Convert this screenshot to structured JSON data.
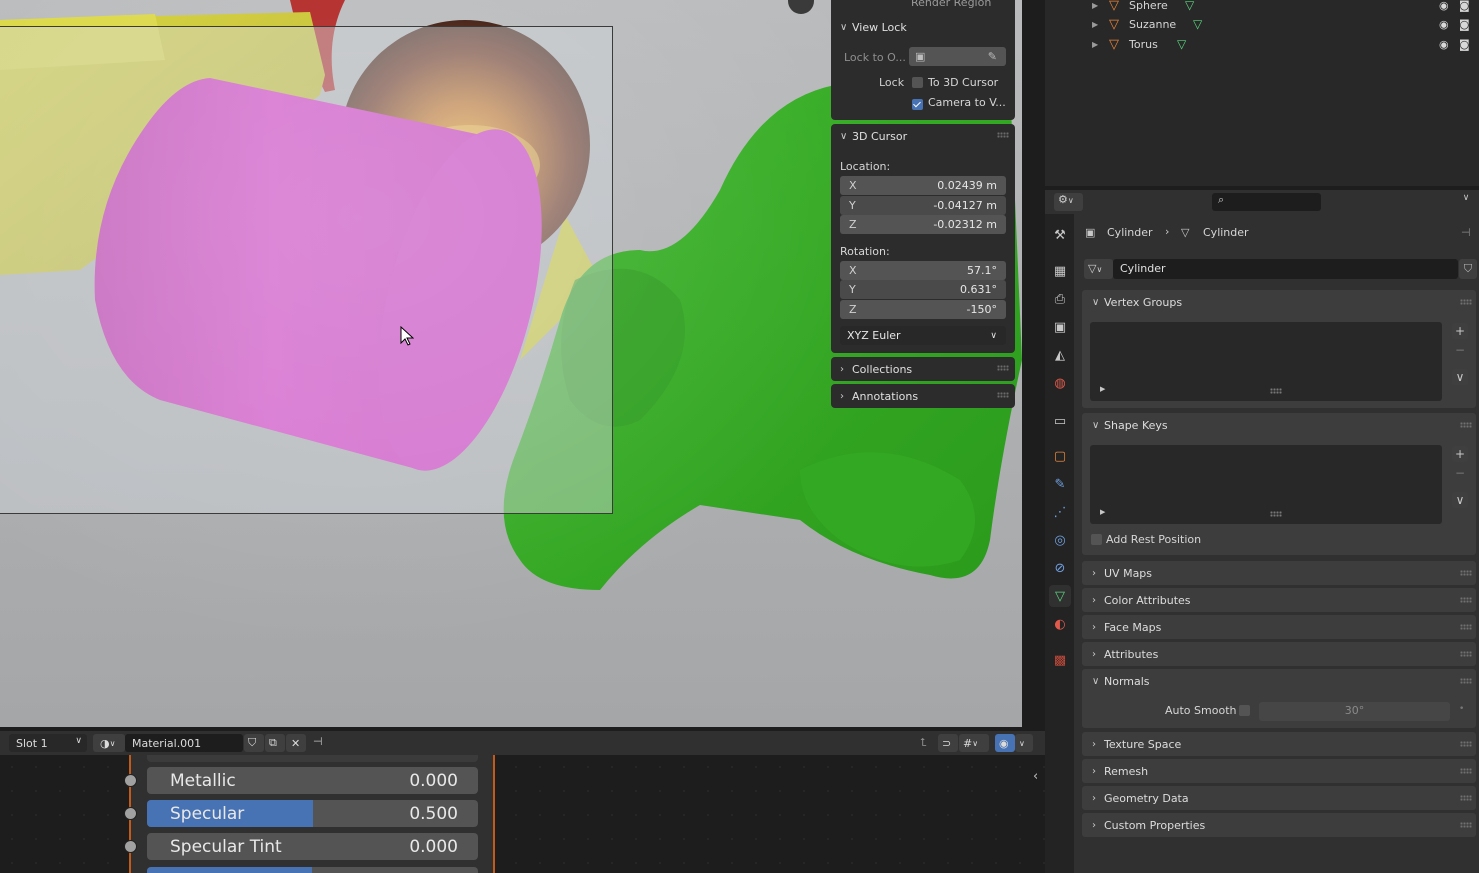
{
  "viewport": {
    "render_region_label": "Render Region",
    "view_lock": {
      "header": "View Lock",
      "lock_to_object_label": "Lock to O...",
      "lock_label": "Lock",
      "to_3d_cursor_label": "To 3D Cursor",
      "to_3d_cursor_checked": false,
      "camera_to_view_label": "Camera to V...",
      "camera_to_view_checked": true
    },
    "cursor": {
      "header": "3D Cursor",
      "location_label": "Location:",
      "location": [
        {
          "axis": "X",
          "value": "0.02439 m"
        },
        {
          "axis": "Y",
          "value": "-0.04127 m"
        },
        {
          "axis": "Z",
          "value": "-0.02312 m"
        }
      ],
      "rotation_label": "Rotation:",
      "rotation": [
        {
          "axis": "X",
          "value": "57.1°"
        },
        {
          "axis": "Y",
          "value": "0.631°"
        },
        {
          "axis": "Z",
          "value": "-150°"
        }
      ],
      "rotation_mode": "XYZ Euler"
    },
    "collections_header": "Collections",
    "annotations_header": "Annotations"
  },
  "outliner": {
    "items": [
      {
        "name": "Sphere"
      },
      {
        "name": "Suzanne"
      },
      {
        "name": "Torus"
      }
    ]
  },
  "properties": {
    "breadcrumb_object": "Cylinder",
    "breadcrumb_data": "Cylinder",
    "mesh_name": "Cylinder",
    "panels": {
      "vertex_groups": "Vertex Groups",
      "shape_keys": "Shape Keys",
      "add_rest_position": "Add Rest Position",
      "uv_maps": "UV Maps",
      "color_attributes": "Color Attributes",
      "face_maps": "Face Maps",
      "attributes": "Attributes",
      "normals": "Normals",
      "auto_smooth_label": "Auto Smooth",
      "auto_smooth_angle": "30°",
      "texture_space": "Texture Space",
      "remesh": "Remesh",
      "geometry_data": "Geometry Data",
      "custom_properties": "Custom Properties"
    }
  },
  "node_editor": {
    "slot": "Slot 1",
    "material": "Material.001",
    "inputs": [
      {
        "label": "Metallic",
        "value": "0.000",
        "fraction": 0.0
      },
      {
        "label": "Specular",
        "value": "0.500",
        "fraction": 0.5
      },
      {
        "label": "Specular Tint",
        "value": "0.000",
        "fraction": 0.0
      }
    ]
  },
  "colors": {
    "accent": "#4772b3",
    "object_orange": "#e7853b",
    "mesh_green": "#5ad37f"
  }
}
